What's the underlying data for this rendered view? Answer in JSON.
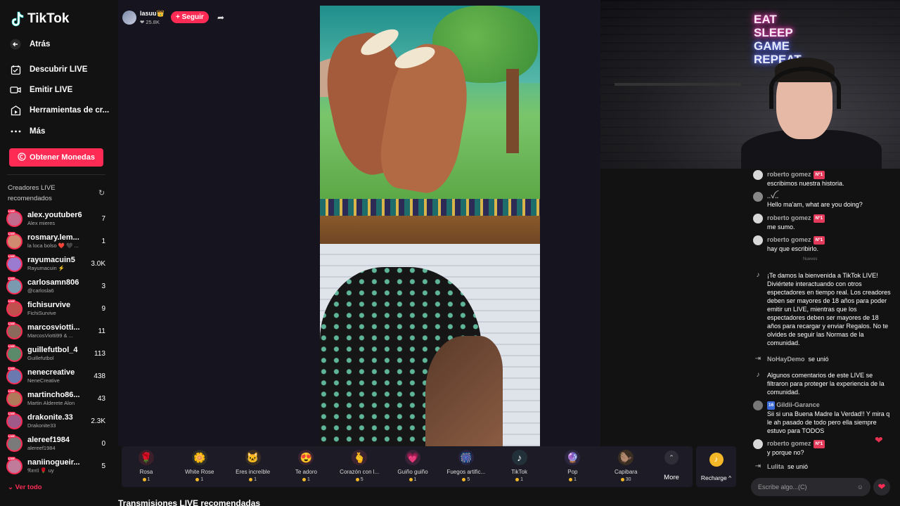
{
  "app": {
    "brand": "TikTok"
  },
  "sidebar": {
    "back": "Atrás",
    "nav": [
      {
        "label": "Descubrir LIVE",
        "icon": "calendar-icon"
      },
      {
        "label": "Emitir LIVE",
        "icon": "camera-icon"
      },
      {
        "label": "Herramientas de cr...",
        "icon": "tools-icon"
      },
      {
        "label": "Más",
        "icon": "more-dots-icon"
      }
    ],
    "coins_button": "Obtener Monedas",
    "recommended_title": "Creadores LIVE recomendados",
    "creators": [
      {
        "name": "alex.youtuber6",
        "sub": "Alex mieres",
        "count": "7",
        "color": "#c46a8d"
      },
      {
        "name": "rosmary.lem...",
        "sub": "la loca bolso ❤️ 🖤 ...",
        "count": "1",
        "color": "#d08a70"
      },
      {
        "name": "rayumacuin5",
        "sub": "Rayumacuin ⚡",
        "count": "3.0K",
        "color": "#9a7bd0"
      },
      {
        "name": "carlosamn806",
        "sub": "@carlosla6",
        "count": "3",
        "color": "#7a9ab0"
      },
      {
        "name": "fichisurvive",
        "sub": "FichiSurvive",
        "count": "9",
        "color": "#c0504d"
      },
      {
        "name": "marcosviotti...",
        "sub": "MarcosViotti99 & ...",
        "count": "11",
        "color": "#8a6a5a"
      },
      {
        "name": "guillefutbol_4",
        "sub": "Guillefutbol",
        "count": "113",
        "color": "#5a8a6a"
      },
      {
        "name": "nenecreative",
        "sub": "NeneCreative",
        "count": "438",
        "color": "#6a7ab0"
      },
      {
        "name": "martincho86...",
        "sub": "Martin Alderete Alon",
        "count": "43",
        "color": "#b07a5a"
      },
      {
        "name": "drakonite.33",
        "sub": "Drakonite33",
        "count": "2.3K",
        "color": "#a05a8a"
      },
      {
        "name": "alereef1984",
        "sub": "alereef1984",
        "count": "0",
        "color": "#7a7a7a"
      },
      {
        "name": "naniinogueir...",
        "sub": "𝔑𝔞𝔫𝔦𝔩 🌹 uy",
        "count": "5",
        "color": "#c07a9a"
      }
    ],
    "see_all": "Ver todo"
  },
  "stream": {
    "host_name": "lasuu👑",
    "host_likes": "❤ 25.8K",
    "follow": "+ Seguir"
  },
  "gifts": [
    {
      "name": "Rosa",
      "price": "1",
      "icon": "rose-icon",
      "glyph": "🌹"
    },
    {
      "name": "White Rose",
      "price": "1",
      "icon": "white-rose-icon",
      "glyph": "🌼"
    },
    {
      "name": "Eres increíble",
      "price": "1",
      "icon": "cat-icon",
      "glyph": "🐱"
    },
    {
      "name": "Te adoro",
      "price": "1",
      "icon": "heart-face-icon",
      "glyph": "😍"
    },
    {
      "name": "Corazón con l...",
      "price": "5",
      "icon": "finger-heart-icon",
      "glyph": "🫰"
    },
    {
      "name": "Guiño guiño",
      "price": "1",
      "icon": "wink-heart-icon",
      "glyph": "💗"
    },
    {
      "name": "Fuegos artific...",
      "price": "5",
      "icon": "fireworks-icon",
      "glyph": "🎆"
    },
    {
      "name": "TikTok",
      "price": "1",
      "icon": "tiktok-gift-icon",
      "glyph": "♪"
    },
    {
      "name": "Pop",
      "price": "1",
      "icon": "pop-icon",
      "glyph": "🔮"
    },
    {
      "name": "Capibara",
      "price": "30",
      "icon": "capybara-icon",
      "glyph": "🦫"
    }
  ],
  "more": "More",
  "recharge": "Recharge ^",
  "recommended_streams": "Transmisiones LIVE recomendadas",
  "webcam": {
    "neon": [
      "EAT",
      "SLEEP",
      "GAME",
      "REPEAT"
    ]
  },
  "chat": {
    "messages": [
      {
        "user": "roberto gomez",
        "badge": "Nº1",
        "text": "escribimos nuestra historia."
      },
      {
        "user": "..ꪜ..",
        "badge": "",
        "text": "Hello ma'am, what are you doing?"
      },
      {
        "user": "roberto gomez",
        "badge": "Nº1",
        "text": "me sumo."
      },
      {
        "user": "roberto gomez",
        "badge": "Nº1",
        "text": "hay que escribirlo."
      }
    ],
    "new_marker": "Nuevos",
    "welcome": "¡Te damos la bienvenida a TikTok LIVE! Diviértete interactuando con otros espectadores en tiempo real. Los creadores deben ser mayores de 18 años para poder emitir un LIVE, mientras que los espectadores deben ser mayores de 18 años para recargar y enviar Regalos. No te olvides de seguir las Normas de la comunidad.",
    "join1_user": "NoHayDemo",
    "join1_text": "se unió",
    "filter_notice": "Algunos comentarios de este LIVE se filtraron para proteger la experiencia de la comunidad.",
    "gildii_level": "16",
    "gildii_user": "Gildii-Garance",
    "gildii_text": "Sii si una Buena Madre la Verdad!! Y mira q le ah pasado de todo pero ella siempre estuvo para TODOS",
    "last_user": "roberto gomez",
    "last_badge": "Nº1",
    "last_text": "y porque no?",
    "join2_user": "Lulita",
    "join2_text": "se unió",
    "input_placeholder": "Escribe algo...(C)"
  }
}
